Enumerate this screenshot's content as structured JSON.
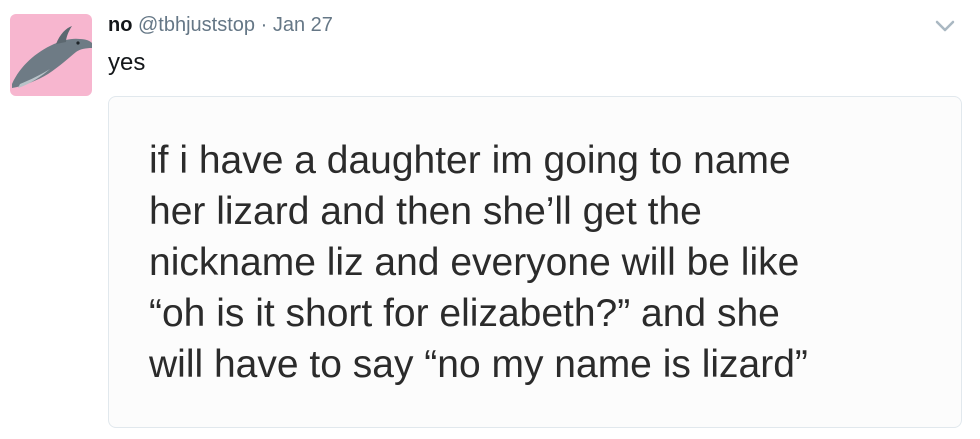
{
  "tweet": {
    "display_name": "no",
    "handle": "@tbhjuststop",
    "separator": "·",
    "date": "Jan 27",
    "text": "yes"
  },
  "image_text": {
    "lines": [
      "if i have a daughter im going to name",
      "her lizard and then she’ll get the",
      "nickname liz and everyone will be like",
      "“oh is it short for elizabeth?” and she",
      "will have to say “no my name is lizard”"
    ]
  },
  "icons": {
    "avatar": "dolphin-avatar",
    "menu": "chevron-down-icon"
  },
  "colors": {
    "avatar_bg": "#f7b6cf",
    "muted": "#657786",
    "text": "#14171a"
  }
}
